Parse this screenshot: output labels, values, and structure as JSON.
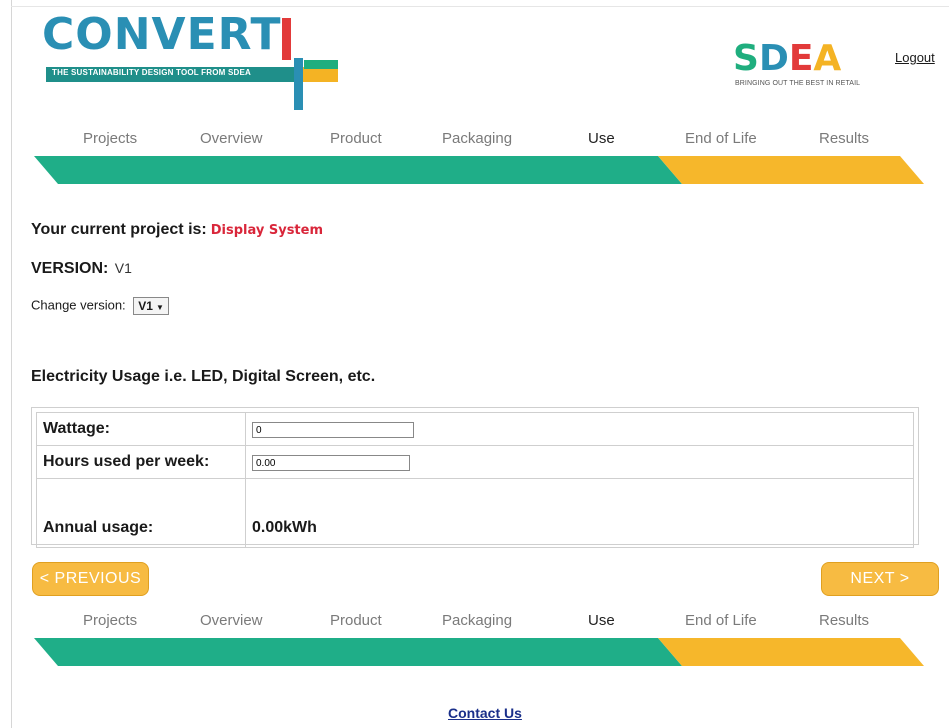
{
  "header": {
    "logo_text": "CONVERT",
    "logo_tagline": "THE SUSTAINABILITY DESIGN TOOL FROM SDEA",
    "partner_logo_text": "SDEA",
    "partner_tagline": "BRINGING OUT THE BEST IN RETAIL",
    "logout_label": "Logout"
  },
  "nav": {
    "items": [
      "Projects",
      "Overview",
      "Product",
      "Packaging",
      "Use",
      "End of Life",
      "Results"
    ],
    "active": "Use"
  },
  "progress": {
    "completed_color": "#1fae88",
    "remaining_color": "#f6b72b",
    "completed_fraction": 0.72
  },
  "project": {
    "current_label": "Your current project is:",
    "name": "Display System",
    "version_label": "VERSION:",
    "version_value": "V1",
    "change_version_label": "Change version:",
    "selected_version": "V1"
  },
  "electricity": {
    "title": "Electricity Usage i.e. LED, Digital Screen, etc.",
    "wattage_label": "Wattage:",
    "wattage_value": "0",
    "hours_label": "Hours used per week:",
    "hours_value": "0.00",
    "annual_label": "Annual usage:",
    "annual_value": "0.00kWh"
  },
  "buttons": {
    "previous": "< PREVIOUS",
    "next": "NEXT >"
  },
  "footer": {
    "contact": "Contact Us"
  }
}
